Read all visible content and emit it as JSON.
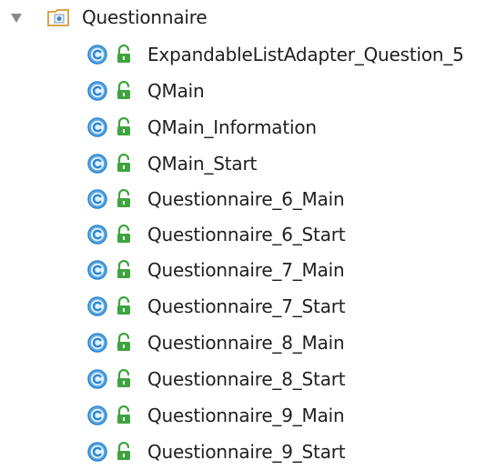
{
  "tree": {
    "package": {
      "label": "Questionnaire",
      "icon": "package-folder-icon",
      "expanded": true
    },
    "classes": [
      {
        "label": "ExpandableListAdapter_Question_5",
        "icon": "class-icon",
        "access_icon": "public-lock-icon"
      },
      {
        "label": "QMain",
        "icon": "class-icon",
        "access_icon": "public-lock-icon"
      },
      {
        "label": "QMain_Information",
        "icon": "class-icon",
        "access_icon": "public-lock-icon"
      },
      {
        "label": "QMain_Start",
        "icon": "class-icon",
        "access_icon": "public-lock-icon"
      },
      {
        "label": "Questionnaire_6_Main",
        "icon": "class-icon",
        "access_icon": "public-lock-icon"
      },
      {
        "label": "Questionnaire_6_Start",
        "icon": "class-icon",
        "access_icon": "public-lock-icon"
      },
      {
        "label": "Questionnaire_7_Main",
        "icon": "class-icon",
        "access_icon": "public-lock-icon"
      },
      {
        "label": "Questionnaire_7_Start",
        "icon": "class-icon",
        "access_icon": "public-lock-icon"
      },
      {
        "label": "Questionnaire_8_Main",
        "icon": "class-icon",
        "access_icon": "public-lock-icon"
      },
      {
        "label": "Questionnaire_8_Start",
        "icon": "class-icon",
        "access_icon": "public-lock-icon"
      },
      {
        "label": "Questionnaire_9_Main",
        "icon": "class-icon",
        "access_icon": "public-lock-icon"
      },
      {
        "label": "Questionnaire_9_Start",
        "icon": "class-icon",
        "access_icon": "public-lock-icon"
      }
    ]
  },
  "colors": {
    "class_icon_fill": "#58a6e0",
    "class_icon_ring": "#2e86d1",
    "lock_icon": "#3fa43f",
    "folder_icon": "#d7a64a",
    "expander": "#8a8a8a",
    "text": "#1f1f1f"
  }
}
